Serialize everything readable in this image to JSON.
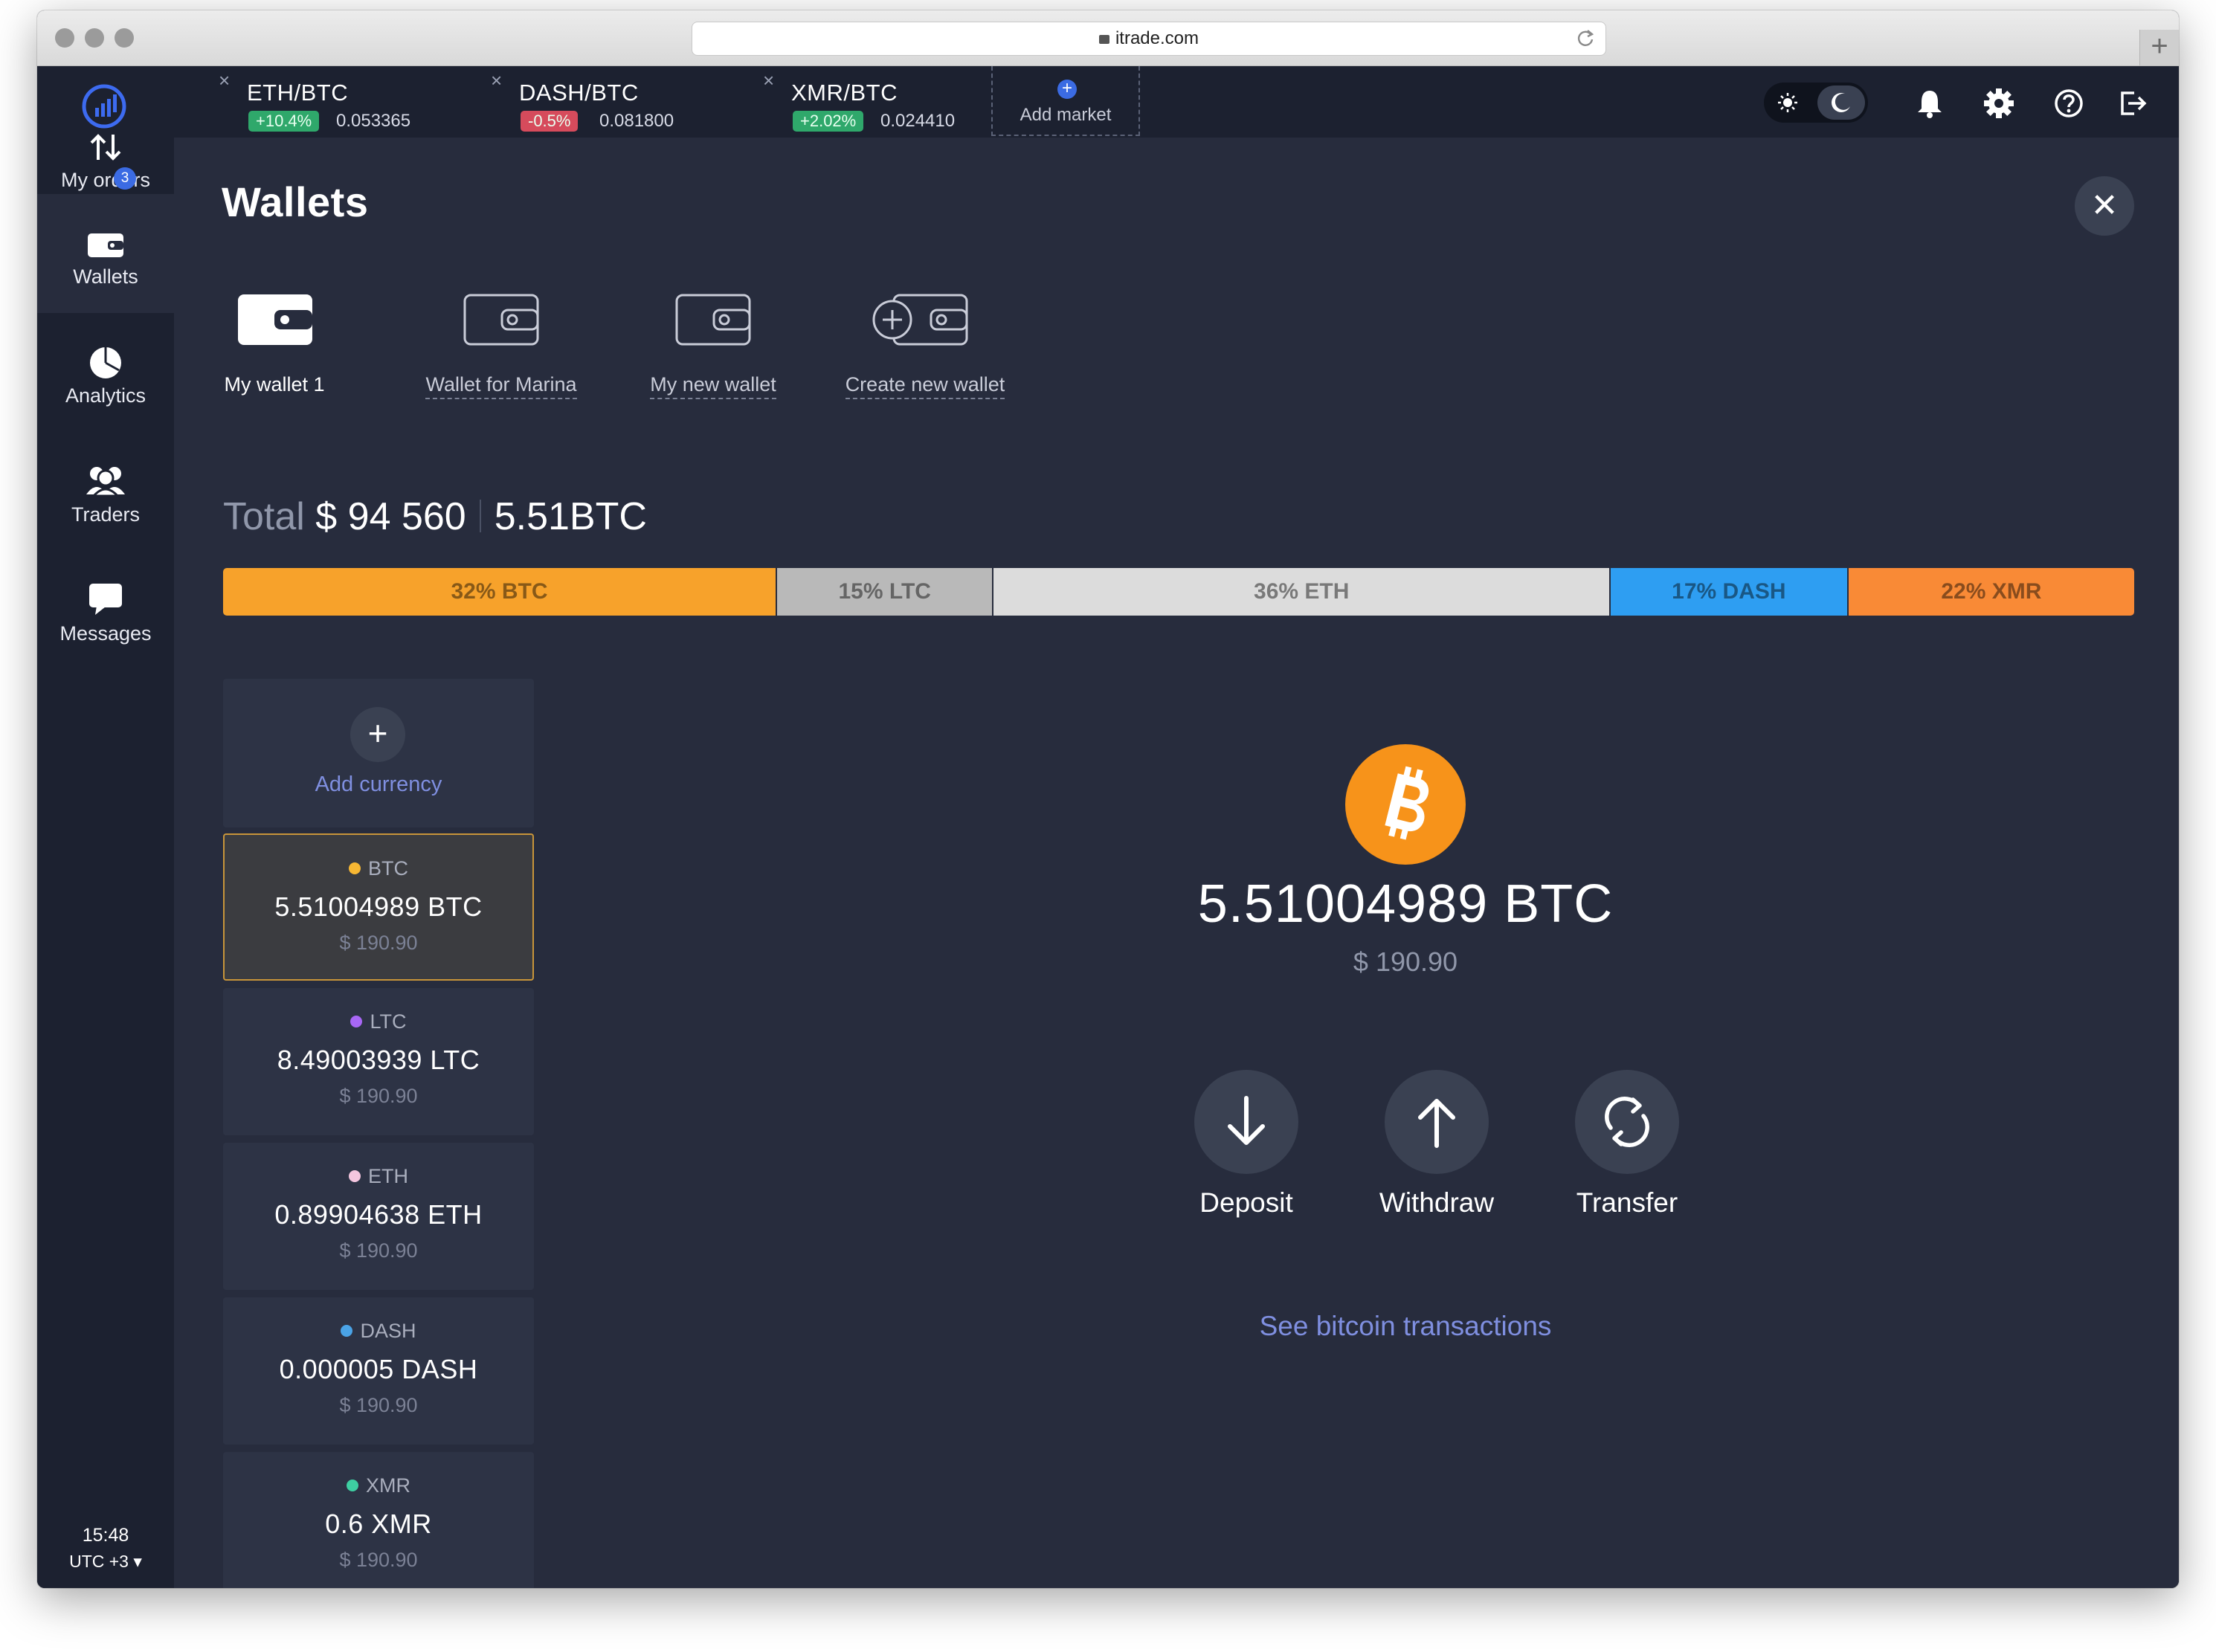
{
  "browser": {
    "url": "itrade.com"
  },
  "sidebar": {
    "items": [
      {
        "label": "My orders",
        "icon": "up-down-arrows-icon",
        "badge": "3"
      },
      {
        "label": "Wallets",
        "icon": "wallet-icon",
        "active": true
      },
      {
        "label": "Analytics",
        "icon": "pie-chart-icon"
      },
      {
        "label": "Traders",
        "icon": "users-icon"
      },
      {
        "label": "Messages",
        "icon": "chat-bubble-icon"
      }
    ],
    "clock": {
      "time": "15:48",
      "timezone": "UTC +3 ▾"
    }
  },
  "topbar": {
    "markets": [
      {
        "pair": "ETH/BTC",
        "change": "+10.4%",
        "direction": "up",
        "price": "0.053365"
      },
      {
        "pair": "DASH/BTC",
        "change": "-0.5%",
        "direction": "down",
        "price": "0.081800"
      },
      {
        "pair": "XMR/BTC",
        "change": "+2.02%",
        "direction": "up",
        "price": "0.024410"
      }
    ],
    "add_market_label": "Add market",
    "close_glyph": "×",
    "add_glyph": "+"
  },
  "colors": {
    "up": "#2fa86b",
    "down": "#d64b5c",
    "accent": "#3b6be3",
    "link": "#7f8fe0",
    "btc": "#f7931a"
  },
  "page": {
    "title": "Wallets",
    "close_glyph": "✕"
  },
  "wallets": [
    {
      "label": "My wallet 1",
      "active": true
    },
    {
      "label": "Wallet for Marina"
    },
    {
      "label": "My new wallet"
    },
    {
      "label": "Create new wallet",
      "create": true
    }
  ],
  "total": {
    "label": "Total",
    "usd": "$ 94 560",
    "btc": "5.51BTC"
  },
  "distribution": [
    {
      "label": "32% BTC",
      "percent": 29,
      "color": "#f7a22b"
    },
    {
      "label": "15% LTC",
      "percent": 11.3,
      "color": "#b9b9b9"
    },
    {
      "label": "36% ETH",
      "percent": 32.3,
      "color": "#dcdcdc"
    },
    {
      "label": "17% DASH",
      "percent": 12.4,
      "color": "#2e9ef2"
    },
    {
      "label": "22% XMR",
      "percent": 15,
      "color": "#f98a36"
    }
  ],
  "currencies": {
    "add_label": "Add currency",
    "add_glyph": "+",
    "items": [
      {
        "symbol": "BTC",
        "amount": "5.51004989 BTC",
        "usd": "$ 190.90",
        "dot": "#f7b733",
        "selected": true
      },
      {
        "symbol": "LTC",
        "amount": "8.49003939 LTC",
        "usd": "$ 190.90",
        "dot": "#a867f5"
      },
      {
        "symbol": "ETH",
        "amount": "0.89904638 ETH",
        "usd": "$ 190.90",
        "dot": "#f4c6df"
      },
      {
        "symbol": "DASH",
        "amount": "0.000005 DASH",
        "usd": "$ 190.90",
        "dot": "#4aa3e6"
      },
      {
        "symbol": "XMR",
        "amount": "0.6 XMR",
        "usd": "$ 190.90",
        "dot": "#3ecfa2"
      }
    ]
  },
  "detail": {
    "coin_icon": "bitcoin-logo-icon",
    "amount": "5.51004989 BTC",
    "usd": "$ 190.90",
    "actions": [
      {
        "label": "Deposit",
        "icon": "arrow-down-icon"
      },
      {
        "label": "Withdraw",
        "icon": "arrow-up-icon"
      },
      {
        "label": "Transfer",
        "icon": "refresh-icon"
      }
    ],
    "transactions_link": "See bitcoin transactions"
  }
}
